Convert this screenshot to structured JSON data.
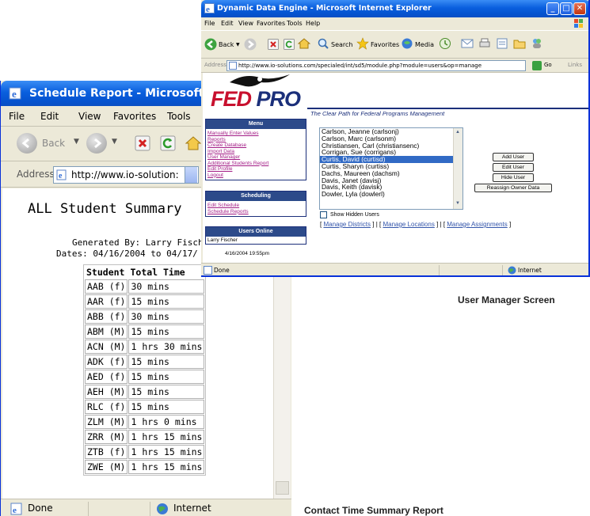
{
  "report_window": {
    "title": "Schedule Report - Microsoft Int",
    "menu": [
      "File",
      "Edit",
      "View",
      "Favorites",
      "Tools"
    ],
    "toolbar": {
      "back_label": "Back"
    },
    "address": {
      "label": "Address",
      "url": "http://www.io-solution:"
    },
    "report": {
      "heading": "ALL Student Summary",
      "generated_by": "Generated By: Larry Fisch",
      "dates": "Dates: 04/16/2004 to 04/17/",
      "columns": [
        "Student",
        "Total Time"
      ],
      "rows": [
        [
          "AAB (f)",
          "30 mins"
        ],
        [
          "AAR (f)",
          "15 mins"
        ],
        [
          "ABB (f)",
          "30 mins"
        ],
        [
          "ABM (M)",
          "15 mins"
        ],
        [
          "ACN (M)",
          "1 hrs 30 mins"
        ],
        [
          "ADK (f)",
          "15 mins"
        ],
        [
          "AED (f)",
          "15 mins"
        ],
        [
          "AEH (M)",
          "15 mins"
        ],
        [
          "RLC (f)",
          "15 mins"
        ],
        [
          "ZLM (M)",
          "1 hrs 0 mins"
        ],
        [
          "ZRR (M)",
          "1 hrs 15 mins"
        ],
        [
          "ZTB (f)",
          "1 hrs 15 mins"
        ],
        [
          "ZWE (M)",
          "1 hrs 15 mins"
        ]
      ]
    },
    "status": {
      "text": "Done",
      "zone": "Internet"
    }
  },
  "engine_window": {
    "title": "Dynamic Data Engine - Microsoft Internet Explorer",
    "menu": [
      "File",
      "Edit",
      "View",
      "Favorites",
      "Tools",
      "Help"
    ],
    "toolbar": {
      "back": "Back",
      "search": "Search",
      "favorites": "Favorites",
      "media": "Media"
    },
    "address": {
      "label": "Address",
      "url": "http://www.io-solutions.com/specialed/int/sd5/module.php?module=users&op=manage",
      "go": "Go",
      "links": "Links"
    },
    "logo": {
      "fed": "FED",
      "pro": "PRO"
    },
    "tagline": "The Clear Path for Federal Programs Management",
    "menu_panel": {
      "header": "Menu",
      "items": [
        "Manually Enter Values",
        "Reports",
        "Create Database",
        "Import Data",
        "User Manager",
        "Additional Students Report",
        "Edit Profile",
        "Logout"
      ]
    },
    "scheduling_panel": {
      "header": "Scheduling",
      "items": [
        "Edit Schedule",
        "Schedule Reports"
      ]
    },
    "online_panel": {
      "header": "Users Online",
      "users": [
        "Larry Fischer"
      ]
    },
    "timestamp": "4/16/2004 19:55pm",
    "users": [
      "Carlson, Jeanne (carlsonj)",
      "Carlson, Marc (carlsonm)",
      "Christiansen, Carl (christiansenc)",
      "Corrigan, Sue (corrigans)",
      "Curtis, David (curtisd)",
      "Curtis, Sharyn (curtiss)",
      "Dachs, Maureen (dachsm)",
      "Davis, Janet (davisj)",
      "Davis, Keith (davisk)",
      "Dowler, Lyla (dowlerl)"
    ],
    "selected_user_index": 4,
    "buttons": {
      "add": "Add User",
      "edit": "Edit User",
      "hide": "Hide User",
      "reassign": "Reassign Owner Data"
    },
    "show_hidden": "Show Hidden Users",
    "links": [
      "Manage Districts",
      "Manage Locations",
      "Manage Assignments"
    ],
    "status": {
      "text": "Done",
      "zone": "Internet"
    }
  },
  "captions": {
    "user_manager": "User Manager Screen",
    "contact_time": "Contact Time Summary Report"
  },
  "colors": {
    "xp_title_blue": "#0a5fde",
    "fed_red": "#c8102e",
    "pro_navy": "#1b2f7a",
    "selection": "#316ac5"
  }
}
